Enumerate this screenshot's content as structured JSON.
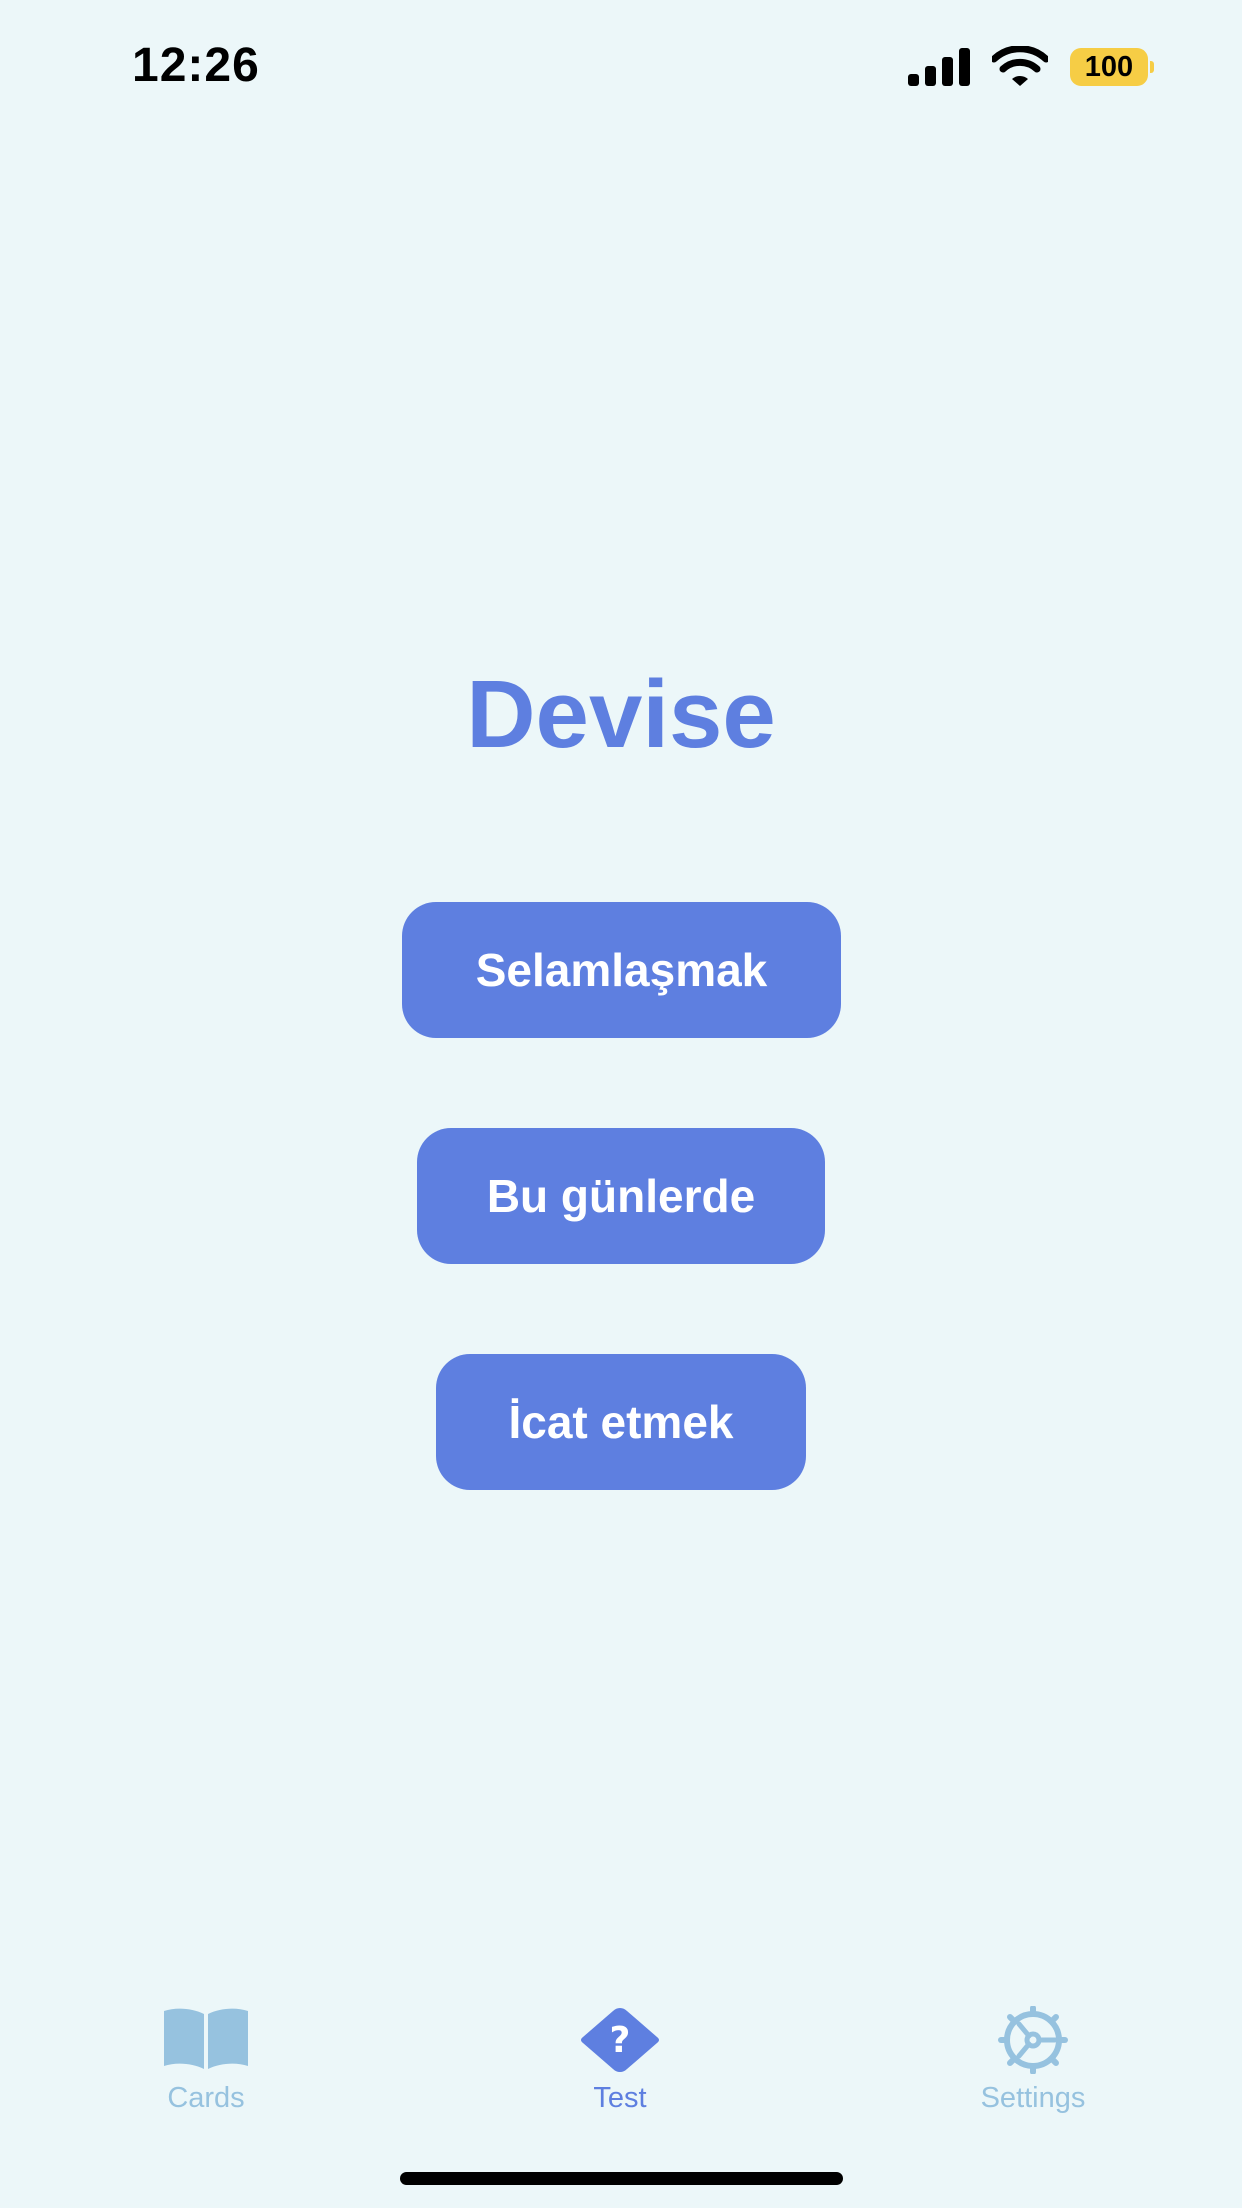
{
  "status_bar": {
    "time": "12:26",
    "battery_level": "100",
    "signal_icon": "cellular-signal-icon",
    "wifi_icon": "wifi-icon",
    "battery_color": "#F6CD45"
  },
  "test": {
    "word": "Devise",
    "choices": [
      "Selamlaşmak",
      "Bu günlerde",
      "İcat etmek"
    ]
  },
  "tab_bar": {
    "tabs": [
      {
        "label": "Cards",
        "icon": "book-icon",
        "active": false
      },
      {
        "label": "Test",
        "icon": "question-diamond-icon",
        "active": true
      },
      {
        "label": "Settings",
        "icon": "gear-icon",
        "active": false
      }
    ]
  },
  "colors": {
    "background": "#ECF7F9",
    "accent": "#5E7FE0",
    "inactive_tab": "#96C2DF"
  }
}
